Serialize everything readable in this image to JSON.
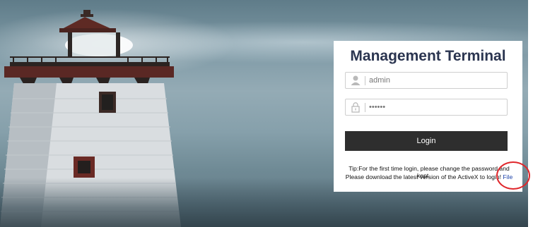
{
  "login": {
    "title": "Management Terminal",
    "username_value": "admin",
    "password_value": "••••••",
    "login_label": "Login",
    "tip_line1": "Tip:For the first time login, please change the password and",
    "tip_overlap": "kept.",
    "tip_line2": "Please download the latest version of the ActiveX to login!",
    "file_link": "File"
  },
  "icons": {
    "username": "user-icon",
    "password": "lock-icon"
  },
  "colors": {
    "title": "#2b3550",
    "button": "#2e2e2e",
    "link": "#1a3fa8",
    "annotation": "#e0262b"
  }
}
